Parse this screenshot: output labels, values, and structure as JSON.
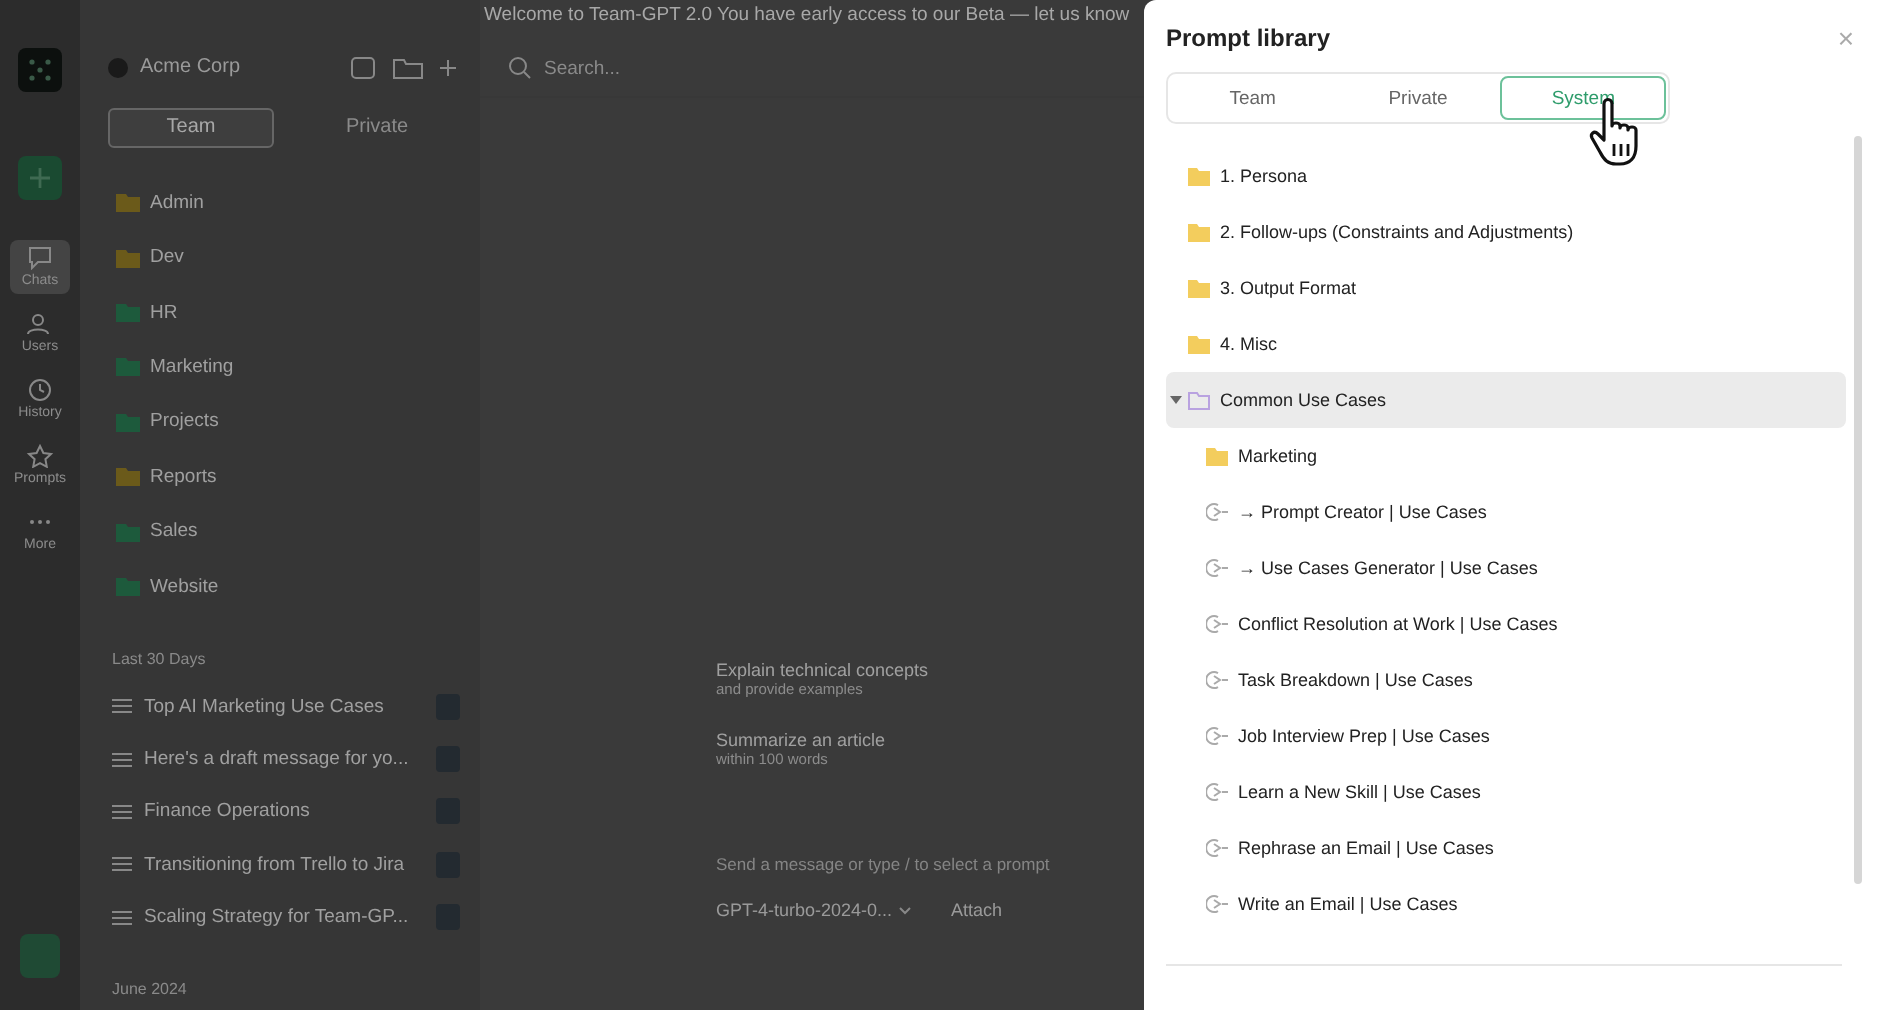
{
  "banner": {
    "text": "Welcome to Team-GPT 2.0 You have early access to our Beta — let us know"
  },
  "rail": {
    "items": [
      {
        "label": "Chats",
        "selected": true
      },
      {
        "label": "Users",
        "selected": false
      },
      {
        "label": "History",
        "selected": false
      },
      {
        "label": "Prompts",
        "selected": false
      },
      {
        "label": "More",
        "selected": false
      }
    ]
  },
  "workspace": {
    "name": "Acme Corp"
  },
  "sidebar": {
    "tabs": [
      {
        "label": "Team",
        "selected": true
      },
      {
        "label": "Private",
        "selected": false
      }
    ],
    "folders": [
      {
        "label": "Admin",
        "color": "#6b5a1a"
      },
      {
        "label": "Dev",
        "color": "#6b5a1a"
      },
      {
        "label": "HR",
        "color": "#1d5a3c"
      },
      {
        "label": "Marketing",
        "color": "#1d5a3c"
      },
      {
        "label": "Projects",
        "color": "#1d5a3c"
      },
      {
        "label": "Reports",
        "color": "#6b5a1a"
      },
      {
        "label": "Sales",
        "color": "#1d5a3c"
      },
      {
        "label": "Website",
        "color": "#1d5a3c"
      }
    ],
    "sections": [
      {
        "heading": "Last 30 Days",
        "chats": [
          "Top AI Marketing Use Cases",
          "Here's a draft message for yo...",
          "Finance Operations",
          "Transitioning from Trello to Jira",
          "Scaling Strategy for Team-GP..."
        ]
      },
      {
        "heading": "June 2024"
      }
    ]
  },
  "main": {
    "search": {
      "placeholder": "Search..."
    },
    "suggestions": [
      {
        "title": "Explain technical concepts",
        "subtitle": "and provide examples"
      },
      {
        "title": "Summarize an article",
        "subtitle": "within 100 words"
      }
    ],
    "composer": {
      "placeholder": "Send a message or type / to select a prompt",
      "model": "GPT-4-turbo-2024-0...",
      "attach": "Attach"
    }
  },
  "panel": {
    "title": "Prompt library",
    "close": "×",
    "tabs": [
      {
        "label": "Team",
        "selected": false
      },
      {
        "label": "Private",
        "selected": false
      },
      {
        "label": "System",
        "selected": true
      }
    ],
    "tree": [
      {
        "kind": "folder",
        "label": "1. Persona",
        "selected": false
      },
      {
        "kind": "folder",
        "label": "2. Follow-ups (Constraints and Adjustments)",
        "selected": false
      },
      {
        "kind": "folder",
        "label": "3. Output Format",
        "selected": false
      },
      {
        "kind": "folder",
        "label": "4. Misc",
        "selected": false
      },
      {
        "kind": "folder",
        "label": "Common Use Cases",
        "expanded": true,
        "selected": true,
        "children": [
          {
            "kind": "folder",
            "label": "Marketing",
            "selected": false
          },
          {
            "kind": "prompt",
            "label": "→ Prompt Creator | Use Cases",
            "selected": false
          },
          {
            "kind": "prompt",
            "label": "→ Use Cases Generator | Use Cases",
            "selected": false
          },
          {
            "kind": "prompt",
            "label": "Conflict Resolution at Work | Use Cases",
            "selected": false
          },
          {
            "kind": "prompt",
            "label": "Task Breakdown | Use Cases",
            "selected": false
          },
          {
            "kind": "prompt",
            "label": "Job Interview Prep | Use Cases",
            "selected": false
          },
          {
            "kind": "prompt",
            "label": "Learn a New Skill | Use Cases",
            "selected": false
          },
          {
            "kind": "prompt",
            "label": "Rephrase an Email | Use Cases",
            "selected": false
          },
          {
            "kind": "prompt",
            "label": "Write an Email | Use Cases",
            "selected": false
          }
        ]
      }
    ]
  }
}
